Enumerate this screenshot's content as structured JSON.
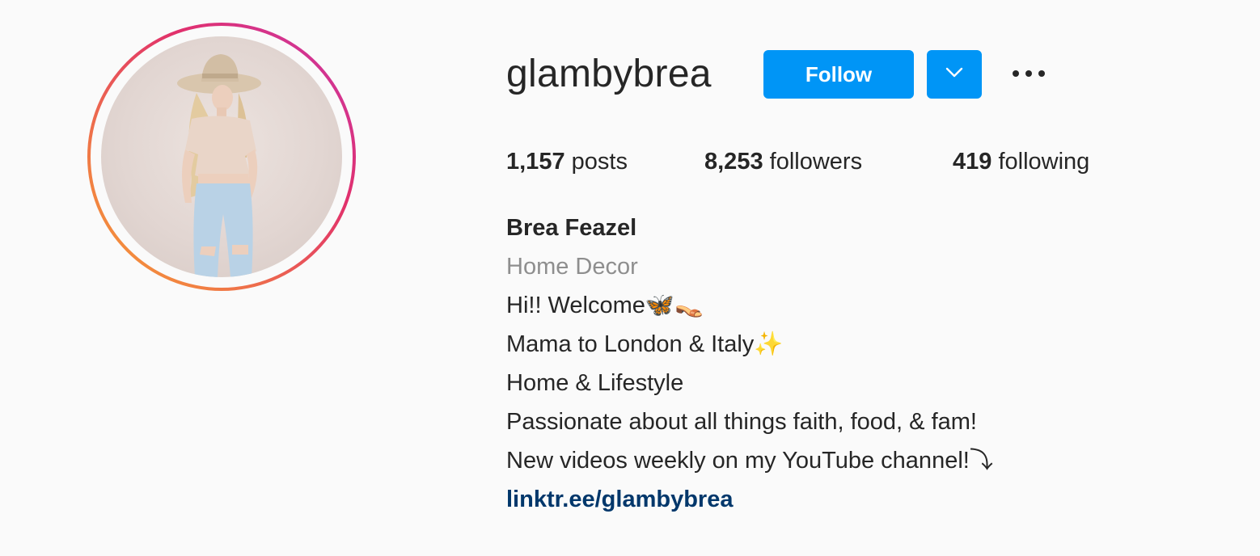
{
  "profile": {
    "username": "glambybrea",
    "follow_label": "Follow",
    "dropdown_icon": "chevron-down-icon",
    "more_icon": "more-options-icon"
  },
  "stats": {
    "posts_count": "1,157",
    "posts_label": "posts",
    "followers_count": "8,253",
    "followers_label": "followers",
    "following_count": "419",
    "following_label": "following"
  },
  "bio": {
    "full_name": "Brea Feazel",
    "category": "Home Decor",
    "lines": [
      "Hi!! Welcome🦋👡",
      "Mama to London & Italy✨",
      "Home & Lifestyle",
      "Passionate about all things faith, food, & fam!",
      "New videos weekly on my YouTube channel!⤵"
    ],
    "link": "linktr.ee/glambybrea"
  },
  "colors": {
    "accent": "#0095f6",
    "link": "#00376b",
    "muted": "#8e8e8e",
    "text": "#262626",
    "background": "#fafafa"
  }
}
